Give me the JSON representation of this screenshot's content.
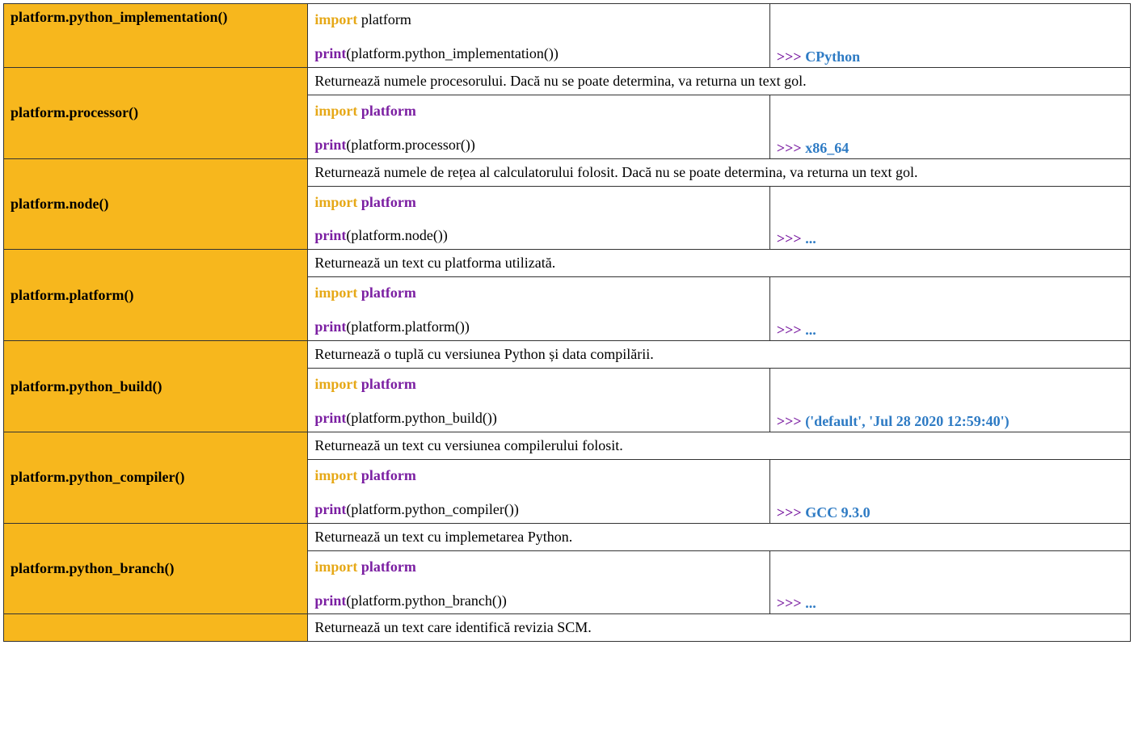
{
  "rows": [
    {
      "fn": "platform.python_implementation()",
      "desc": null,
      "code_import_kw": "import",
      "code_import_mod": "platform",
      "code_import_mod_bold": false,
      "code_call_fn": "print",
      "code_call_args": "(platform.python_implementation())",
      "out_prompt": ">>>",
      "out_value": "CPython"
    },
    {
      "fn": "platform.processor()",
      "desc": "Returnează numele procesorului. Dacă nu se poate determina, va returna un text gol.",
      "code_import_kw": "import",
      "code_import_mod": "platform",
      "code_import_mod_bold": true,
      "code_call_fn": "print",
      "code_call_args": "(platform.processor())",
      "out_prompt": ">>>",
      "out_value": "x86_64"
    },
    {
      "fn": "platform.node()",
      "desc": "Returnează numele de rețea al calculatorului folosit. Dacă nu se poate determina, va returna un text gol.",
      "code_import_kw": "import",
      "code_import_mod": "platform",
      "code_import_mod_bold": true,
      "code_call_fn": "print",
      "code_call_args": "(platform.node())",
      "out_prompt": ">>>",
      "out_value": "..."
    },
    {
      "fn": "platform.platform()",
      "desc": "Returnează un text cu platforma utilizată.",
      "code_import_kw": "import",
      "code_import_mod": "platform",
      "code_import_mod_bold": true,
      "code_call_fn": "print",
      "code_call_args": "(platform.platform())",
      "out_prompt": ">>>",
      "out_value": "..."
    },
    {
      "fn": "platform.python_build()",
      "desc": "Returnează o tuplă cu versiunea Python și data compilării.",
      "code_import_kw": "import",
      "code_import_mod": "platform",
      "code_import_mod_bold": true,
      "code_call_fn": "print",
      "code_call_args": "(platform.python_build())",
      "out_prompt": ">>>",
      "out_value": "('default', 'Jul 28 2020 12:59:40')"
    },
    {
      "fn": "platform.python_compiler()",
      "desc": "Returnează un text cu versiunea compilerului folosit.",
      "code_import_kw": "import",
      "code_import_mod": "platform",
      "code_import_mod_bold": true,
      "code_call_fn": "print",
      "code_call_args": "(platform.python_compiler())",
      "out_prompt": ">>>",
      "out_value": "GCC 9.3.0"
    },
    {
      "fn": "platform.python_branch()",
      "desc": "Returnează un text cu implemetarea Python.",
      "code_import_kw": "import",
      "code_import_mod": "platform",
      "code_import_mod_bold": true,
      "code_call_fn": "print",
      "code_call_args": "(platform.python_branch())",
      "out_prompt": ">>>",
      "out_value": "..."
    }
  ],
  "tail": {
    "fn": "",
    "desc": "Returnează un text care identifică revizia SCM."
  }
}
